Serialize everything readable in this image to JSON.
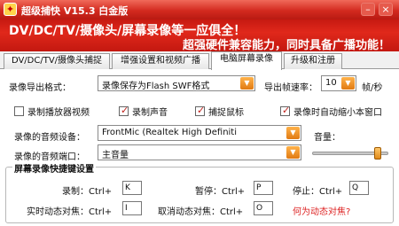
{
  "window": {
    "title": "超级捕快 V15.3 白金版",
    "minimize": "–",
    "close": "×"
  },
  "banner": {
    "line1": "DV/DC/TV/摄像头/屏幕录像等一应俱全！",
    "line2": "超强硬件兼容能力，同时具备广播功能！"
  },
  "tabs": [
    {
      "label": "DV/DC/TV/摄像头捕捉",
      "active": false
    },
    {
      "label": "增强设置和视频广播",
      "active": false
    },
    {
      "label": "电脑屏幕录像",
      "active": true
    },
    {
      "label": "升级和注册",
      "active": false
    }
  ],
  "export": {
    "format_label": "录像导出格式：",
    "format_value": "录像保存为Flash SWF格式",
    "fps_label": "导出帧速率：",
    "fps_value": "10",
    "fps_unit": "帧/秒"
  },
  "checkboxes": [
    {
      "label": "录制播放器视频",
      "checked": false
    },
    {
      "label": "录制声音",
      "checked": true
    },
    {
      "label": "捕捉鼠标",
      "checked": true
    },
    {
      "label": "录像时自动缩小本窗口",
      "checked": true
    }
  ],
  "audio": {
    "device_label": "录像的音频设备：",
    "device_value": "FrontMic (Realtek High Definiti",
    "port_label": "录像的音频端口：",
    "port_value": "主音量",
    "volume_label": "音量：",
    "volume_level": 0.9
  },
  "hotkeys": {
    "group_title": "屏幕录像快捷键设置",
    "record_label": "录制：Ctrl+",
    "record_key": "K",
    "pause_label": "暂停：Ctrl+",
    "pause_key": "P",
    "stop_label": "停止：Ctrl+",
    "stop_key": "Q",
    "focus_label": "实时动态对焦：Ctrl+",
    "focus_key": "I",
    "cancel_focus_label": "取消动态对焦：Ctrl+",
    "cancel_focus_key": "O",
    "help_link": "何为动态对焦?"
  }
}
